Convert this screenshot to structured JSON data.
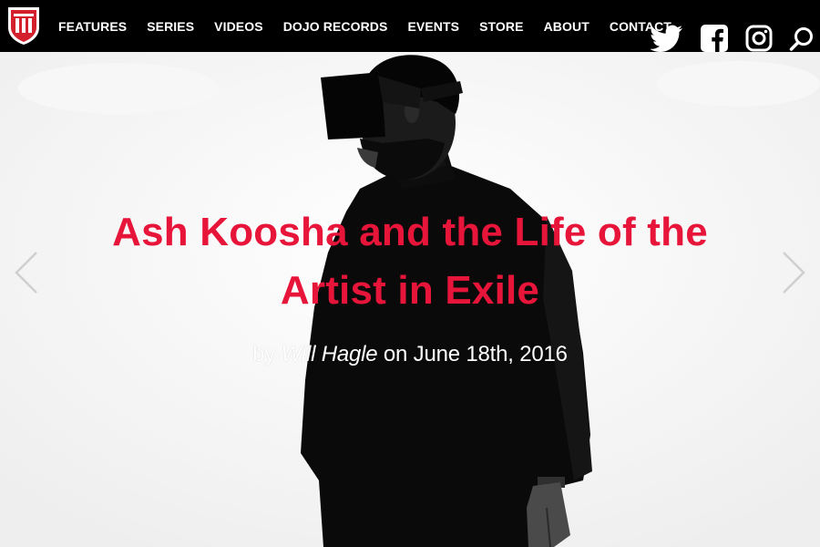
{
  "nav": {
    "menu": [
      {
        "label": "FEATURES"
      },
      {
        "label": "SERIES"
      },
      {
        "label": "VIDEOS"
      },
      {
        "label": "DOJO RECORDS"
      },
      {
        "label": "EVENTS"
      },
      {
        "label": "STORE"
      },
      {
        "label": "ABOUT"
      },
      {
        "label": "CONTACT"
      }
    ],
    "social_icons": [
      "twitter-icon",
      "facebook-icon",
      "instagram-icon",
      "search-icon"
    ]
  },
  "hero": {
    "headline": "Ash Koosha and the Life of the Artist in Exile",
    "byline_prefix": "by",
    "author": "Will Hagle",
    "byline_suffix": "on June 18th, 2016",
    "prev_icon": "chevron-left-icon",
    "next_icon": "chevron-right-icon"
  },
  "colors": {
    "nav_background": "#000000",
    "headline": "#e8153a",
    "logo_red": "#d41f2c",
    "byline": "#ffffff"
  }
}
